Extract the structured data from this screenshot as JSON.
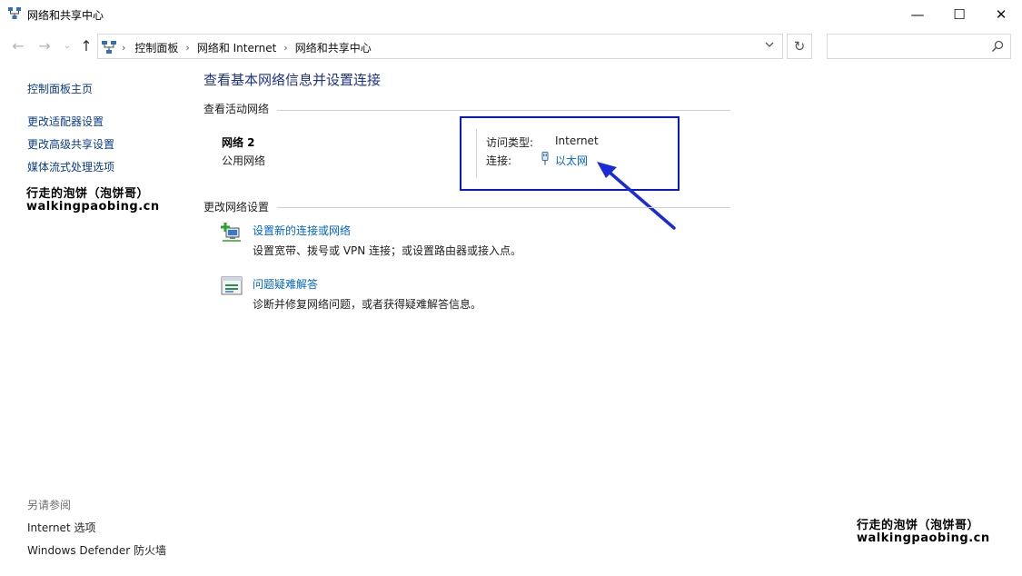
{
  "window": {
    "title": "网络和共享中心",
    "minimize_glyph": "—",
    "maximize_glyph": "☐",
    "close_glyph": "✕"
  },
  "nav": {
    "back_glyph": "←",
    "forward_glyph": "→",
    "history_glyph": "⌄",
    "up_glyph": "↑",
    "breadcrumbs": [
      "控制面板",
      "网络和 Internet",
      "网络和共享中心"
    ],
    "refresh_glyph": "↻",
    "search_placeholder": ""
  },
  "sidebar": {
    "home_link": "控制面板主页",
    "links": [
      "更改适配器设置",
      "更改高级共享设置",
      "媒体流式处理选项"
    ],
    "watermark_line1": "行走的泡饼（泡饼哥）",
    "watermark_line2": "walkingpaobing.cn",
    "see_also_label": "另请参阅",
    "see_also_links": [
      "Internet 选项",
      "Windows Defender 防火墙"
    ]
  },
  "main": {
    "page_title": "查看基本网络信息并设置连接",
    "active_networks_heading": "查看活动网络",
    "network": {
      "name": "网络 2",
      "category": "公用网络",
      "access_type_label": "访问类型:",
      "access_type_value": "Internet",
      "connections_label": "连接:",
      "connection_link": "以太网"
    },
    "change_settings_heading": "更改网络设置",
    "tasks": [
      {
        "title": "设置新的连接或网络",
        "description": "设置宽带、拨号或 VPN 连接；或设置路由器或接入点。"
      },
      {
        "title": "问题疑难解答",
        "description": "诊断并修复网络问题，或者获得疑难解答信息。"
      }
    ]
  },
  "watermark": {
    "line1": "行走的泡饼（泡饼哥）",
    "line2": "walkingpaobing.cn"
  },
  "annotation": {
    "box_color": "#0b17d1",
    "arrow_color": "#1a2bd9"
  }
}
